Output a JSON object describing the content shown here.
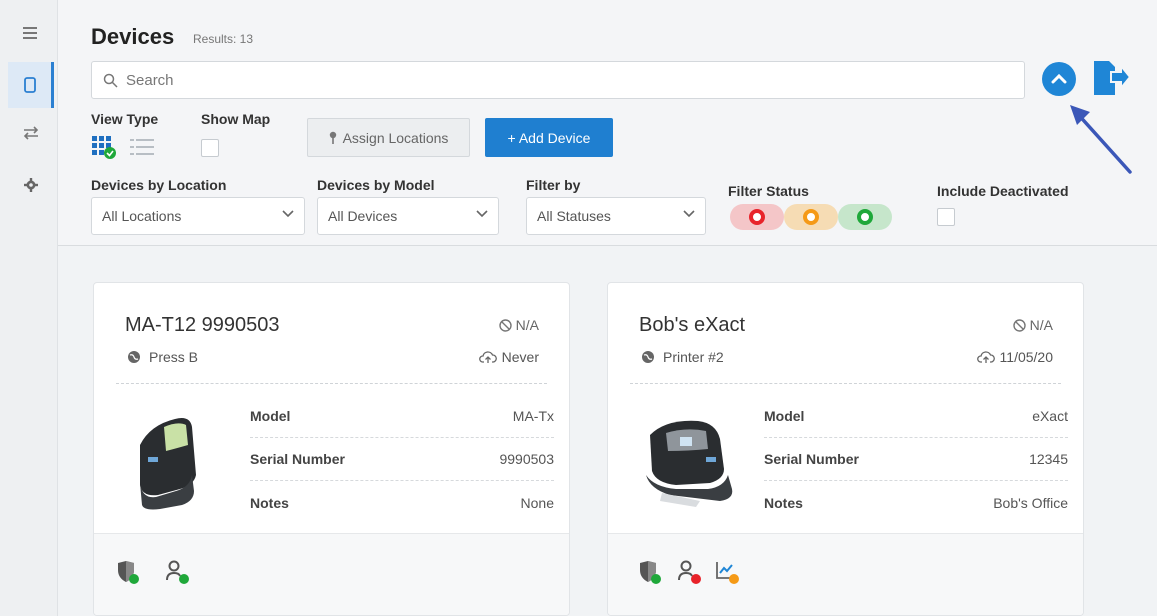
{
  "nav": {
    "items": [
      {
        "icon": "menu-icon"
      },
      {
        "icon": "device-icon",
        "active": true
      },
      {
        "icon": "transfer-icon"
      },
      {
        "icon": "gear-icon"
      }
    ]
  },
  "header": {
    "title": "Devices",
    "results": "Results: 13",
    "search_placeholder": "Search"
  },
  "view_type": {
    "label": "View Type",
    "options": [
      "grid-view-icon",
      "list-view-icon"
    ],
    "selected": "grid"
  },
  "show_map": {
    "label": "Show Map",
    "checked": false
  },
  "buttons": {
    "assign_locations": "Assign Locations",
    "add_device": "+ Add Device"
  },
  "filters": {
    "location": {
      "label": "Devices by Location",
      "value": "All Locations"
    },
    "model": {
      "label": "Devices by Model",
      "value": "All Devices"
    },
    "filter_by": {
      "label": "Filter by",
      "value": "All Statuses"
    },
    "status": {
      "label": "Filter Status",
      "colors": [
        "#e8232a",
        "#f59a17",
        "#1fa83a"
      ]
    },
    "include_deactivated": {
      "label": "Include Deactivated",
      "checked": false
    }
  },
  "devices": [
    {
      "name": "MA-T12 9990503",
      "status": "N/A",
      "location": "Press B",
      "last_sync": "Never",
      "attributes": [
        {
          "key": "Model",
          "value": "MA-Tx"
        },
        {
          "key": "Serial Number",
          "value": "9990503"
        },
        {
          "key": "Notes",
          "value": "None"
        }
      ],
      "footer_icons": [
        "shield-icon",
        "user-key-icon"
      ]
    },
    {
      "name": "Bob's eXact",
      "status": "N/A",
      "location": "Printer #2",
      "last_sync": "11/05/20",
      "attributes": [
        {
          "key": "Model",
          "value": "eXact"
        },
        {
          "key": "Serial Number",
          "value": "12345"
        },
        {
          "key": "Notes",
          "value": "Bob's Office"
        }
      ],
      "footer_icons": [
        "shield-icon",
        "user-key-icon",
        "trend-chart-icon"
      ]
    }
  ],
  "colors": {
    "accent": "#1f7fd0",
    "green": "#1fa83a",
    "red": "#e8232a",
    "orange": "#f59a17"
  }
}
